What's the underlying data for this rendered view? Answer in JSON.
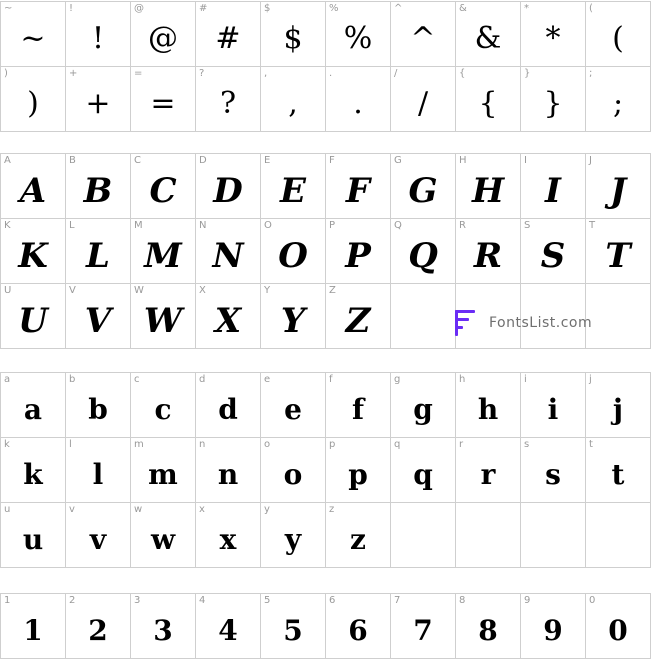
{
  "sections": [
    {
      "id": "punctuation",
      "rows": [
        [
          {
            "hint": "~",
            "glyph": "~"
          },
          {
            "hint": "!",
            "glyph": "!"
          },
          {
            "hint": "@",
            "glyph": "@"
          },
          {
            "hint": "#",
            "glyph": "#"
          },
          {
            "hint": "$",
            "glyph": "$"
          },
          {
            "hint": "%",
            "glyph": "%"
          },
          {
            "hint": "^",
            "glyph": "^"
          },
          {
            "hint": "&",
            "glyph": "&"
          },
          {
            "hint": "*",
            "glyph": "*"
          },
          {
            "hint": "(",
            "glyph": "("
          }
        ],
        [
          {
            "hint": ")",
            "glyph": ")"
          },
          {
            "hint": "+",
            "glyph": "+"
          },
          {
            "hint": "=",
            "glyph": "="
          },
          {
            "hint": "?",
            "glyph": "?"
          },
          {
            "hint": ",",
            "glyph": ","
          },
          {
            "hint": ".",
            "glyph": "."
          },
          {
            "hint": "/",
            "glyph": "/"
          },
          {
            "hint": "{",
            "glyph": "{"
          },
          {
            "hint": "}",
            "glyph": "}"
          },
          {
            "hint": ";",
            "glyph": ";"
          }
        ]
      ]
    },
    {
      "id": "uppercase",
      "rows": [
        [
          {
            "hint": "A",
            "glyph": "A"
          },
          {
            "hint": "B",
            "glyph": "B"
          },
          {
            "hint": "C",
            "glyph": "C"
          },
          {
            "hint": "D",
            "glyph": "D"
          },
          {
            "hint": "E",
            "glyph": "E"
          },
          {
            "hint": "F",
            "glyph": "F"
          },
          {
            "hint": "G",
            "glyph": "G"
          },
          {
            "hint": "H",
            "glyph": "H"
          },
          {
            "hint": "I",
            "glyph": "I"
          },
          {
            "hint": "J",
            "glyph": "J"
          }
        ],
        [
          {
            "hint": "K",
            "glyph": "K"
          },
          {
            "hint": "L",
            "glyph": "L"
          },
          {
            "hint": "M",
            "glyph": "M"
          },
          {
            "hint": "N",
            "glyph": "N"
          },
          {
            "hint": "O",
            "glyph": "O"
          },
          {
            "hint": "P",
            "glyph": "P"
          },
          {
            "hint": "Q",
            "glyph": "Q"
          },
          {
            "hint": "R",
            "glyph": "R"
          },
          {
            "hint": "S",
            "glyph": "S"
          },
          {
            "hint": "T",
            "glyph": "T"
          }
        ],
        [
          {
            "hint": "U",
            "glyph": "U"
          },
          {
            "hint": "V",
            "glyph": "V"
          },
          {
            "hint": "W",
            "glyph": "W"
          },
          {
            "hint": "X",
            "glyph": "X"
          },
          {
            "hint": "Y",
            "glyph": "Y"
          },
          {
            "hint": "Z",
            "glyph": "Z"
          }
        ]
      ]
    },
    {
      "id": "lowercase",
      "rows": [
        [
          {
            "hint": "a",
            "glyph": "a"
          },
          {
            "hint": "b",
            "glyph": "b"
          },
          {
            "hint": "c",
            "glyph": "c"
          },
          {
            "hint": "d",
            "glyph": "d"
          },
          {
            "hint": "e",
            "glyph": "e"
          },
          {
            "hint": "f",
            "glyph": "f"
          },
          {
            "hint": "g",
            "glyph": "g"
          },
          {
            "hint": "h",
            "glyph": "h"
          },
          {
            "hint": "i",
            "glyph": "i"
          },
          {
            "hint": "j",
            "glyph": "j"
          }
        ],
        [
          {
            "hint": "k",
            "glyph": "k"
          },
          {
            "hint": "l",
            "glyph": "l"
          },
          {
            "hint": "m",
            "glyph": "m"
          },
          {
            "hint": "n",
            "glyph": "n"
          },
          {
            "hint": "o",
            "glyph": "o"
          },
          {
            "hint": "p",
            "glyph": "p"
          },
          {
            "hint": "q",
            "glyph": "q"
          },
          {
            "hint": "r",
            "glyph": "r"
          },
          {
            "hint": "s",
            "glyph": "s"
          },
          {
            "hint": "t",
            "glyph": "t"
          }
        ],
        [
          {
            "hint": "u",
            "glyph": "u"
          },
          {
            "hint": "v",
            "glyph": "v"
          },
          {
            "hint": "w",
            "glyph": "w"
          },
          {
            "hint": "x",
            "glyph": "x"
          },
          {
            "hint": "y",
            "glyph": "y"
          },
          {
            "hint": "z",
            "glyph": "z"
          }
        ]
      ]
    },
    {
      "id": "digits",
      "rows": [
        [
          {
            "hint": "1",
            "glyph": "1"
          },
          {
            "hint": "2",
            "glyph": "2"
          },
          {
            "hint": "3",
            "glyph": "3"
          },
          {
            "hint": "4",
            "glyph": "4"
          },
          {
            "hint": "5",
            "glyph": "5"
          },
          {
            "hint": "6",
            "glyph": "6"
          },
          {
            "hint": "7",
            "glyph": "7"
          },
          {
            "hint": "8",
            "glyph": "8"
          },
          {
            "hint": "9",
            "glyph": "9"
          },
          {
            "hint": "0",
            "glyph": "0"
          }
        ]
      ]
    }
  ],
  "brand": {
    "text": "FontsList.com",
    "accent": "#6a2cf5"
  }
}
